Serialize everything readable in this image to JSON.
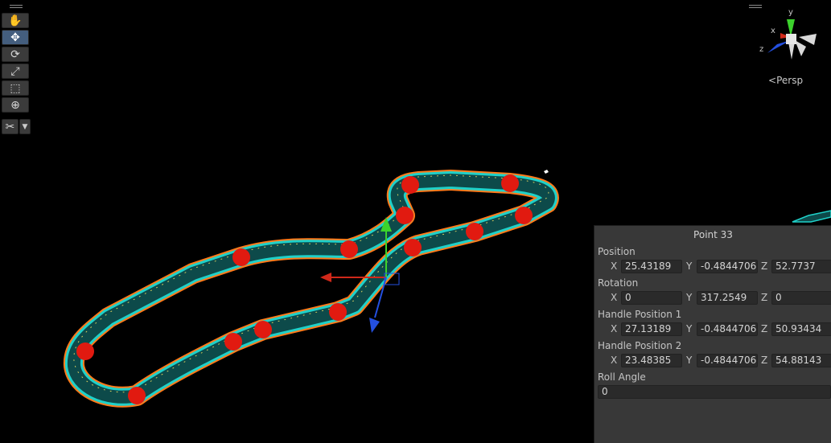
{
  "toolbar": {
    "tools": [
      {
        "name": "hand-tool",
        "icon": "hand-icon",
        "glyph": "✋",
        "active": false
      },
      {
        "name": "move-tool",
        "icon": "move-icon",
        "glyph": "✥",
        "active": true
      },
      {
        "name": "rotate-tool",
        "icon": "rotate-icon",
        "glyph": "⟳",
        "active": false
      },
      {
        "name": "scale-tool",
        "icon": "scale-icon",
        "glyph": "⤢",
        "active": false
      },
      {
        "name": "rect-tool",
        "icon": "rect-icon",
        "glyph": "⬚",
        "active": false
      },
      {
        "name": "transform-tool",
        "icon": "transform-icon",
        "glyph": "⊕",
        "active": false
      }
    ],
    "custom_tool_icon": "wrench-icon",
    "custom_glyph": "✂",
    "dropdown_glyph": "▼"
  },
  "gizmo": {
    "y_label": "y",
    "x_label": "x",
    "z_label": "z",
    "projection": "Persp",
    "projection_glyph": "<"
  },
  "inspector": {
    "title": "Point 33",
    "position": {
      "label": "Position",
      "x": "25.43189",
      "y": "-0.4844706",
      "z": "52.7737"
    },
    "rotation": {
      "label": "Rotation",
      "x": "0",
      "y": "317.2549",
      "z": "0"
    },
    "handle1": {
      "label": "Handle Position 1",
      "x": "27.13189",
      "y": "-0.4844706",
      "z": "50.93434"
    },
    "handle2": {
      "label": "Handle Position 2",
      "x": "23.48385",
      "y": "-0.4844706",
      "z": "54.88143"
    },
    "roll": {
      "label": "Roll Angle",
      "value": "0"
    },
    "axis_x": "X",
    "axis_y": "Y",
    "axis_z": "Z"
  },
  "colors": {
    "background": "#000000",
    "track_outline": "#ff7a1a",
    "track_fill": "#0d4a4a",
    "track_edge": "#1fd1c9",
    "control_point": "#e11a10",
    "gizmo_x": "#d0281a",
    "gizmo_y": "#3cd22c",
    "gizmo_z": "#2450e0",
    "panel": "#383838"
  }
}
